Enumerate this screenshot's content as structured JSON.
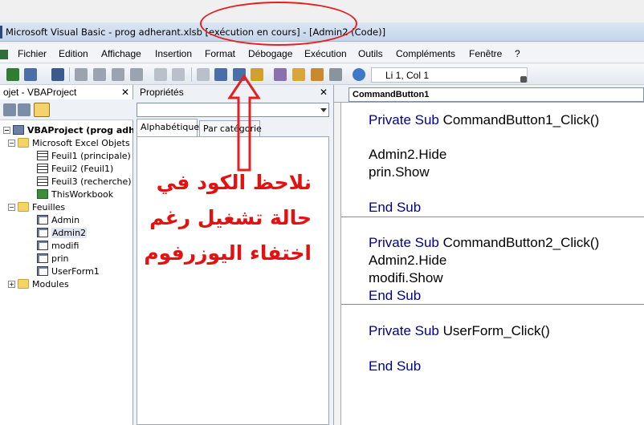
{
  "window": {
    "title": "Microsoft Visual Basic - prog adherant.xlsb [exécution en cours] - [Admin2 (Code)]"
  },
  "menu": {
    "items": [
      "Fichier",
      "Edition",
      "Affichage",
      "Insertion",
      "Format",
      "Débogage",
      "Exécution",
      "Outils",
      "Compléments",
      "Fenêtre",
      "?"
    ]
  },
  "toolbar": {
    "status": "Li 1, Col 1"
  },
  "project": {
    "title": "ojet - VBAProject",
    "tree": [
      {
        "label": "VBAProject (prog adhera",
        "icon": "project-icon"
      },
      {
        "label": "Microsoft Excel Objets",
        "icon": "folder-icon"
      },
      {
        "label": "Feuil1 (principale)",
        "icon": "sheet-icon"
      },
      {
        "label": "Feuil2 (Feuil1)",
        "icon": "sheet-icon"
      },
      {
        "label": "Feuil3 (recherche)",
        "icon": "sheet-icon"
      },
      {
        "label": "ThisWorkbook",
        "icon": "workbook-icon"
      },
      {
        "label": "Feuilles",
        "icon": "folder-icon"
      },
      {
        "label": "Admin",
        "icon": "form-icon"
      },
      {
        "label": "Admin2",
        "icon": "form-icon"
      },
      {
        "label": "modifi",
        "icon": "form-icon"
      },
      {
        "label": "prin",
        "icon": "form-icon"
      },
      {
        "label": "UserForm1",
        "icon": "form-icon"
      },
      {
        "label": "Modules",
        "icon": "folder-icon"
      }
    ]
  },
  "properties": {
    "title": "Propriétés",
    "tabs": [
      "Alphabétique",
      "Par catégorie"
    ]
  },
  "code": {
    "object": "CommandButton1",
    "lines": [
      {
        "kw": "Private Sub",
        "rest": " CommandButton1_Click()"
      },
      {
        "kw": "",
        "rest": "Admin2.Hide"
      },
      {
        "kw": "",
        "rest": "prin.Show"
      },
      {
        "kw": "End Sub",
        "rest": ""
      },
      {
        "kw": "Private Sub",
        "rest": " CommandButton2_Click()"
      },
      {
        "kw": "",
        "rest": "Admin2.Hide"
      },
      {
        "kw": "",
        "rest": "modifi.Show"
      },
      {
        "kw": "End Sub",
        "rest": ""
      },
      {
        "kw": "Private Sub",
        "rest": " UserForm_Click()"
      },
      {
        "kw": "End Sub",
        "rest": ""
      }
    ]
  },
  "annotation": {
    "lines": [
      "نلاحظ الكود في",
      "حالة تشغيل رغم",
      "اختفاء اليوزرفوم"
    ],
    "color": "#e51010"
  },
  "colors": {
    "keyword": "#00008b",
    "annotation": "#e52020"
  }
}
